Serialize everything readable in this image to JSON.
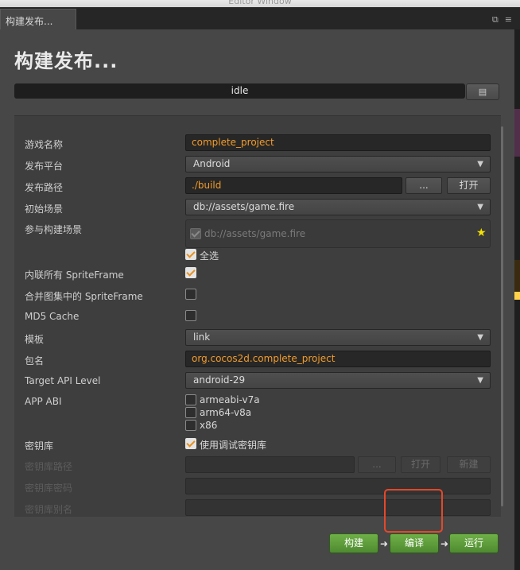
{
  "window_title": "Editor Window",
  "tab": {
    "label": "构建发布..."
  },
  "page_title": "构建发布...",
  "status": "idle",
  "form": {
    "game_name": {
      "label": "游戏名称",
      "value": "complete_project"
    },
    "platform": {
      "label": "发布平台",
      "value": "Android"
    },
    "build_path": {
      "label": "发布路径",
      "value": "./build",
      "browse": "...",
      "open": "打开"
    },
    "start_scene": {
      "label": "初始场景",
      "value": "db://assets/game.fire"
    },
    "scenes": {
      "label": "参与构建场景",
      "scene_item": "db://assets/game.fire",
      "select_all": "全选"
    },
    "inline_spriteframe": {
      "label": "内联所有 SpriteFrame",
      "checked": true
    },
    "merge_spriteframe": {
      "label": "合并图集中的 SpriteFrame",
      "checked": false
    },
    "md5_cache": {
      "label": "MD5 Cache",
      "checked": false
    },
    "template": {
      "label": "模板",
      "value": "link"
    },
    "package_name": {
      "label": "包名",
      "value": "org.cocos2d.complete_project"
    },
    "target_api": {
      "label": "Target API Level",
      "value": "android-29"
    },
    "app_abi": {
      "label": "APP ABI",
      "options": [
        "armeabi-v7a",
        "arm64-v8a",
        "x86"
      ]
    },
    "keystore": {
      "label": "密钥库",
      "debug_label": "使用调试密钥库",
      "checked": true
    },
    "keystore_path": {
      "label": "密钥库路径",
      "browse": "...",
      "open": "打开",
      "new": "新建"
    },
    "keystore_password": {
      "label": "密钥库密码"
    },
    "keystore_alias": {
      "label": "密钥库别名"
    }
  },
  "actions": {
    "build": "构建",
    "compile": "编译",
    "run": "运行"
  },
  "colors": {
    "accent": "#f39c2a",
    "green_button": "#5e9e3a",
    "highlight": "#e4482a"
  }
}
